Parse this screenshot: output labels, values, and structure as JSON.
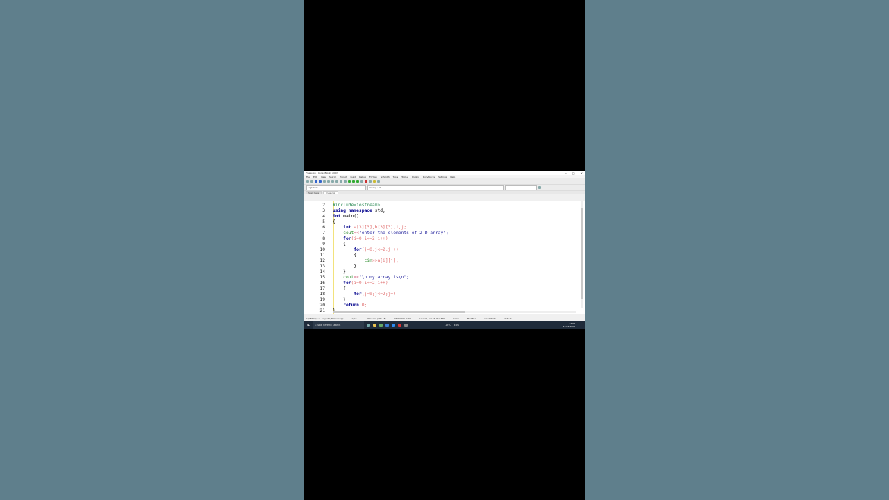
{
  "window": {
    "title": "*new.cpp - Code::Blocks 20.03"
  },
  "menu": [
    "File",
    "Edit",
    "View",
    "Search",
    "Project",
    "Build",
    "Debug",
    "Fortran",
    "wxSmith",
    "Tools",
    "Tools+",
    "Plugins",
    "DoxyBlocks",
    "Settings",
    "Help"
  ],
  "toolbar": {
    "scope": "<global>",
    "symbol": "main() : int"
  },
  "tabs": {
    "start": "Start here",
    "file": "*new.cpp"
  },
  "line_numbers": [
    "2",
    "3",
    "4",
    "5",
    "6",
    "7",
    "8",
    "9",
    "10",
    "11",
    "12",
    "13",
    "14",
    "15",
    "16",
    "17",
    "18",
    "19",
    "20",
    "21"
  ],
  "code": {
    "l2": "#include<iostream>",
    "l3a": "using namespace",
    "l3b": " std;",
    "l4a": "int",
    "l4b": " main()",
    "l5": "{",
    "l6a": "    int",
    "l6b": " a[3][3],b[3][3],i,j;",
    "l7a": "    cout",
    "l7b": "<<",
    "l7c": "\"enter the elements of 2-D array\";",
    "l8a": "    for",
    "l8b": "(i=0;i<=2;i++)",
    "l9": "    {",
    "l10a": "        for",
    "l10b": "(j=0;j<=2;j++)",
    "l11": "        {",
    "l12a": "            cin",
    "l12b": ">>a[i][j];",
    "l13": "        }",
    "l14": "    }",
    "l15a": "    cout",
    "l15b": "<<",
    "l15c": "\"\\n my array is\\n\";",
    "l16a": "    for",
    "l16b": "(i=0;i<=2;i++)",
    "l17": "    {",
    "l18a": "        for",
    "l18b": "(j=0;j<=2;j+)",
    "l19": "    }",
    "l20a": "    return",
    "l20b": " 0;",
    "l21": "}"
  },
  "status": {
    "path": "D:\\MEDIA\\c++ projects\\MIA\\new.cpp",
    "lang": "C/C++",
    "eol": "Windows (CR+LF)",
    "enc": "WINDOWS-1252",
    "pos": "Line 18, Col 24, Pos 376",
    "mode": "Insert",
    "mod": "Modified",
    "rw": "Read/Write",
    "profile": "default"
  },
  "taskbar": {
    "search_placeholder": "Type here to search",
    "weather": "19°C",
    "lang": "ENG",
    "time": "14:04",
    "date": "21-01-2023"
  }
}
